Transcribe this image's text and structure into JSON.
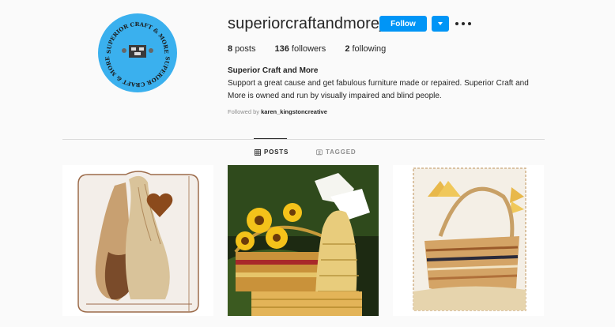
{
  "profile": {
    "username": "superiorcraftandmoreja",
    "follow_label": "Follow",
    "full_name": "Superior Craft and More",
    "bio": "Support a great cause and get fabulous furniture made or repaired. Superior Craft and More is owned and run by visually impaired and blind people.",
    "followed_by_prefix": "Followed by ",
    "followed_by_user": "karen_kingstoncreative",
    "avatar_text": "SUPERIOR CRAFT & MORE",
    "icons": {
      "dropdown": "chevron-down-icon",
      "more": "more-options-icon",
      "posts_tab": "grid-icon",
      "tagged_tab": "tag-icon"
    }
  },
  "stats": {
    "posts_count": "8",
    "posts_label": " posts",
    "followers_count": "136",
    "followers_label": " followers",
    "following_count": "2",
    "following_label": " following"
  },
  "tabs": [
    {
      "label": "POSTS"
    },
    {
      "label": "TAGGED"
    }
  ],
  "colors": {
    "accent": "#0095f6",
    "avatar_bg": "#3ab0ee"
  }
}
